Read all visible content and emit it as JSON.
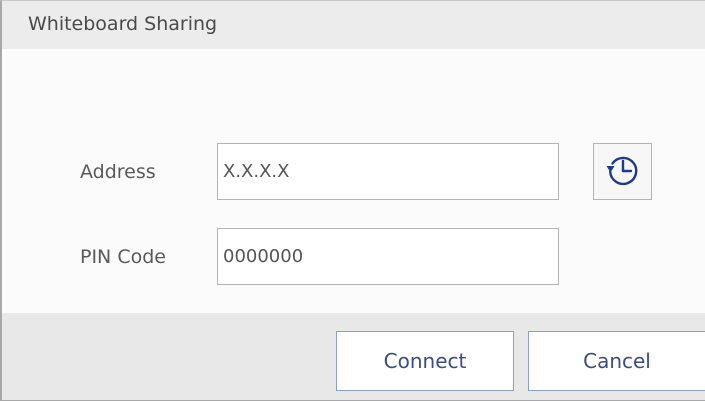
{
  "dialog": {
    "title": "Whiteboard Sharing"
  },
  "form": {
    "address_label": "Address",
    "address_value": "X.X.X.X",
    "pin_label": "PIN Code",
    "pin_value": "0000000",
    "history_icon": "history-clock-icon"
  },
  "footer": {
    "connect_label": "Connect",
    "cancel_label": "Cancel"
  },
  "colors": {
    "titlebar_bg": "#ececec",
    "footer_bg": "#e8e8e8",
    "button_text": "#3c4d86",
    "button_border": "#8e9fc8"
  }
}
